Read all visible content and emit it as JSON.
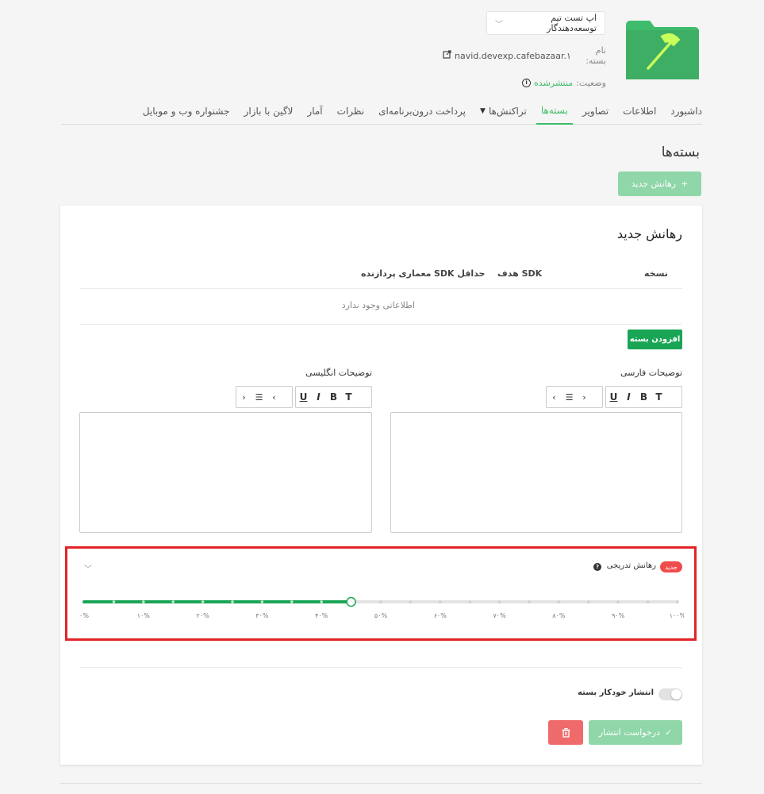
{
  "header": {
    "app_select_value": "اپ تست تیم توسعه‌دهندگار",
    "package_label": "نام بسته:",
    "package_value": "navid.devexp.cafebazaar.۱",
    "status_label": "وضعیت:",
    "status_value": "منتشرشده"
  },
  "tabs": [
    {
      "label": "داشبورد"
    },
    {
      "label": "اطلاعات"
    },
    {
      "label": "تصاویر"
    },
    {
      "label": "بسته‌ها"
    },
    {
      "label": "تراکنش‌ها"
    },
    {
      "label": "پرداخت درون‌برنامه‌ای"
    },
    {
      "label": "نظرات"
    },
    {
      "label": "آمار"
    },
    {
      "label": "لاگین با بازار"
    },
    {
      "label": "جشنواره وب و موبایل"
    }
  ],
  "page_title": "بسته‌ها",
  "new_release_button": "رهانش جدید",
  "card": {
    "title": "رهانش جدید",
    "table_headers": {
      "version": "نسخه",
      "target_sdk": "SDK هدف",
      "min_sdk": "حداقل SDK",
      "arch": "معماری پردازنده"
    },
    "empty_message": "اطلاعاتی وجود ندارد",
    "add_package_button": "افزودن بسته",
    "persian_desc_label": "توضیحات فارسی",
    "english_desc_label": "توضیحات انگلیسی",
    "toolbar": {
      "t": "T",
      "b": "B",
      "i": "I",
      "u": "U",
      "list": "☰",
      "ltr": "›",
      "rtl": "‹"
    }
  },
  "rollout": {
    "badge": "جدید",
    "label": "رهانش تدریجی",
    "help": "?",
    "value_percent": 45,
    "ticks": [
      "۰%",
      "۱۰%",
      "۲۰%",
      "۳۰%",
      "۴۰%",
      "۵۰%",
      "۶۰%",
      "۷۰%",
      "۸۰%",
      "۹۰%",
      "۱۰۰%"
    ],
    "active_color": "#1aa556",
    "inactive_color": "#e4e4e4"
  },
  "auto_publish_label": "انتشار خودکار بسته",
  "publish_button": "درخواست انتشار"
}
